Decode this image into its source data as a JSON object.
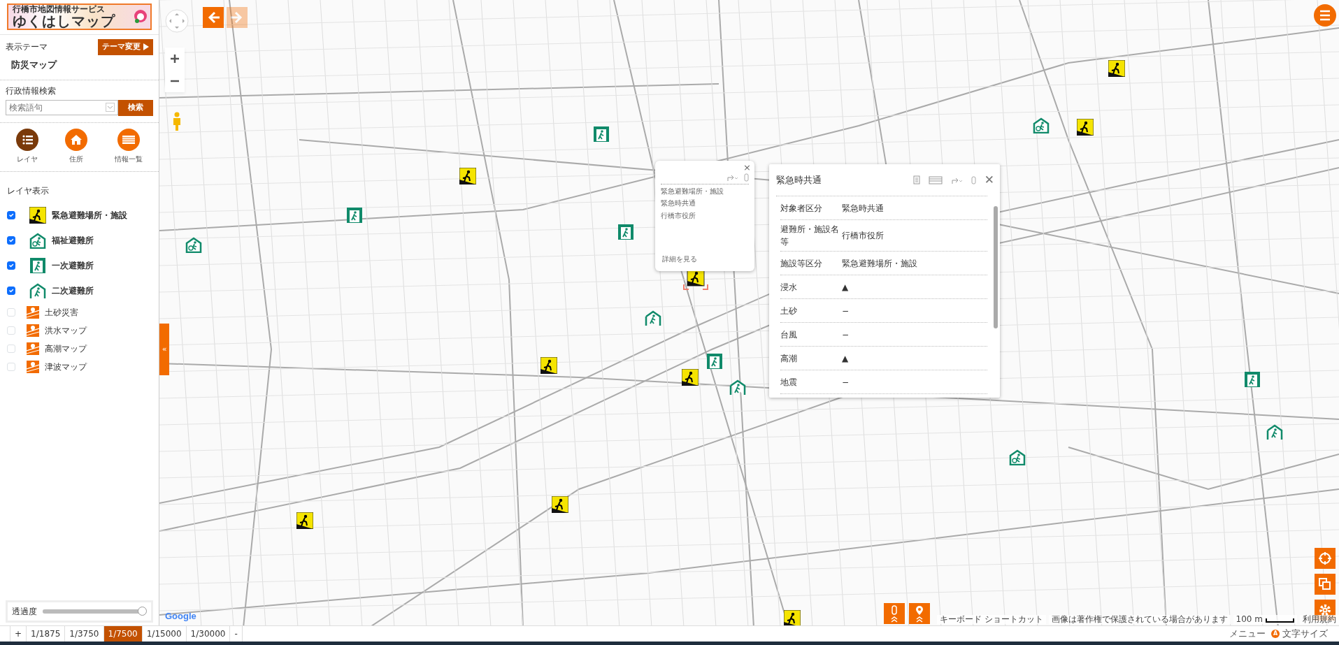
{
  "header": {
    "logo_subtitle": "行橋市地図情報サービス",
    "logo_title": "ゆくはしマップ"
  },
  "theme": {
    "label": "表示テーマ",
    "button": "テーマ変更",
    "value": "防災マップ"
  },
  "search": {
    "label": "行政情報検索",
    "placeholder": "検索語句",
    "button": "検索"
  },
  "tools": [
    {
      "label": "レイヤ",
      "kind": "layers"
    },
    {
      "label": "住所",
      "kind": "house"
    },
    {
      "label": "情報一覧",
      "kind": "list"
    }
  ],
  "layers": {
    "title": "レイヤ表示",
    "items": [
      {
        "label": "緊急避難場所・施設",
        "checked": true,
        "kind": "emergency"
      },
      {
        "label": "福祉避難所",
        "checked": true,
        "kind": "welfare"
      },
      {
        "label": "一次避難所",
        "checked": true,
        "kind": "primary"
      },
      {
        "label": "二次避難所",
        "checked": true,
        "kind": "secondary"
      },
      {
        "label": "土砂災害",
        "checked": false,
        "kind": "hazard"
      },
      {
        "label": "洪水マップ",
        "checked": false,
        "kind": "hazard"
      },
      {
        "label": "高潮マップ",
        "checked": false,
        "kind": "hazard"
      },
      {
        "label": "津波マップ",
        "checked": false,
        "kind": "hazard"
      }
    ]
  },
  "opacity": {
    "label": "透過度",
    "level": 1
  },
  "scales": {
    "zoom_in": "+",
    "zoom_out": "-",
    "items": [
      {
        "label": "1/1875",
        "selected": false
      },
      {
        "label": "1/3750",
        "selected": false
      },
      {
        "label": "1/7500",
        "selected": true
      },
      {
        "label": "1/15000",
        "selected": false
      },
      {
        "label": "1/30000",
        "selected": false
      }
    ]
  },
  "popup": {
    "lines": [
      "緊急避難場所・施設",
      "緊急時共通",
      "行橋市役所"
    ],
    "link": "詳細を見る",
    "close": "×"
  },
  "detail": {
    "title": "緊急時共通",
    "close": "✕",
    "rows": [
      {
        "label": "対象者区分",
        "value": "緊急時共通"
      },
      {
        "label": "避難所・施設名等",
        "value": "行橋市役所"
      },
      {
        "label": "施設等区分",
        "value": "緊急避難場所・施設"
      },
      {
        "label": "浸水",
        "value": "▲"
      },
      {
        "label": "土砂",
        "value": "−"
      },
      {
        "label": "台風",
        "value": "−"
      },
      {
        "label": "高潮",
        "value": "▲"
      },
      {
        "label": "地震",
        "value": "−"
      }
    ]
  },
  "map": {
    "google": "Google",
    "attribution": [
      "キーボード ショートカット",
      "画像は著作権で保護されている場合があります"
    ],
    "scale": "100 m",
    "terms": "利用規約",
    "collapse": "«"
  },
  "footer": {
    "menu": "メニュー",
    "font_badge": "A",
    "font_size": "文字サイズ"
  }
}
